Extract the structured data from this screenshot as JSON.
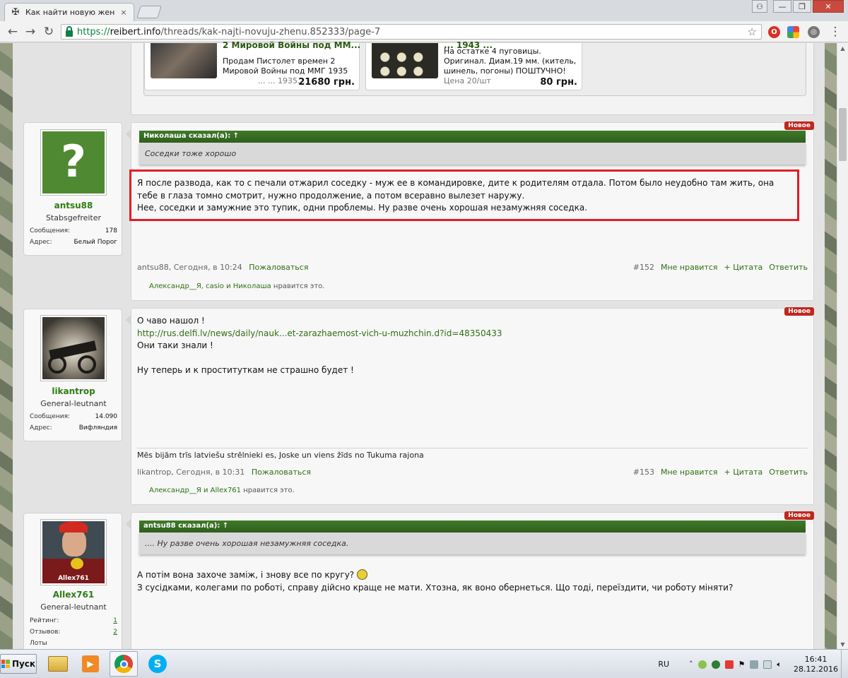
{
  "browser": {
    "tab_title": "Как найти новую жену?",
    "tab_close": "×",
    "url_scheme": "https://",
    "url_host": "reibert.info",
    "url_path": "/threads/kak-najti-novuju-zhenu.852333/page-7",
    "nav": {
      "back": "←",
      "forward": "→",
      "reload": "↻"
    },
    "star": "☆",
    "window_buttons": {
      "user": "⚇",
      "minimize": "—",
      "restore": "❐",
      "close": "✕"
    }
  },
  "ads": [
    {
      "title": "2 Мировой Войны под ММ...",
      "lines": [
        "Продам Пистолет времен 2",
        "Мировой Войны под ММГ 1935"
      ],
      "cut": "... ... 1935...",
      "price": "21680 грн."
    },
    {
      "title": "... 1943 ...",
      "lines": [
        "На остатке 4 пуговицы.",
        "Оригинал. Диам.19 мм. (китель,",
        "шинель, погоны) ПОШТУЧНО!"
      ],
      "cut": "Цена 20/шт",
      "price": "80 грн."
    }
  ],
  "posts": [
    {
      "username": "antsu88",
      "rank": "Stabsgefreiter",
      "stats": [
        {
          "label": "Сообщения:",
          "value": "178"
        },
        {
          "label": "Адрес:",
          "value": "Белый Порог"
        }
      ],
      "badge": "Новое",
      "quote_head": "Николаша сказал(а): ↑",
      "quote_body": "Соседки тоже хорошо",
      "message_lines": [
        "Я после развода, как то с печали отжарил соседку - муж ее в командировке, дите к родителям отдала. Потом было неудобно там жить, она",
        "тебе в глаза томно смотрит, нужно продолжение, а потом всеравно вылезет наружу.",
        "Нее, соседки и замужние это тупик, одни проблемы. Ну разве очень хорошая незамужняя соседка."
      ],
      "meta_author": "antsu88, Сегодня, в 10:24",
      "report": "Пожаловаться",
      "number": "#152",
      "like": "Мне нравится",
      "quote_btn": "+ Цитата",
      "reply": "Ответить",
      "likes_names": "Александр__Я, casio и Николаша",
      "likes_suffix": " нравится это."
    },
    {
      "username": "likantrop",
      "rank": "General-leutnant",
      "stats": [
        {
          "label": "Сообщения:",
          "value": "14.090"
        },
        {
          "label": "Адрес:",
          "value": "Вифляндия"
        }
      ],
      "badge": "Новое",
      "message_lines": [
        "О чаво нашол !",
        "http://rus.delfi.lv/news/daily/nauk...et-zarazhaemost-vich-u-muzhchin.d?id=48350433",
        "Они таки знали !",
        "",
        "Ну теперь и к проституткам не страшно будет !"
      ],
      "signature": "Mēs bijām trīs latviešu strēlnieki es, Joske un viens žīds no Tukuma rajona",
      "meta_author": "likantrop, Сегодня, в 10:31",
      "report": "Пожаловаться",
      "number": "#153",
      "like": "Мне нравится",
      "quote_btn": "+ Цитата",
      "reply": "Ответить",
      "likes_names": "Александр__Я и Allex761",
      "likes_suffix": " нравится это."
    },
    {
      "username": "Allex761",
      "rank": "General-leutnant",
      "avatar_caption": "Allex761",
      "stats": [
        {
          "label": "Рейтинг:",
          "value": "1"
        },
        {
          "label": "Отзывов:",
          "value": "2"
        },
        {
          "label": "Лоты",
          "value": ""
        }
      ],
      "badge": "Новое",
      "quote_head": "antsu88 сказал(а): ↑",
      "quote_body": ".... Ну разве очень хорошая незамужняя соседка.",
      "message_lines": [
        "А потім вона захоче заміж, і знову все по кругу?",
        "З сусідками, колегами по роботі, справу дійсно краще не мати. Хтозна, як воно обернеться. Що тоді, переїздити, чи роботу міняти?"
      ]
    }
  ],
  "taskbar": {
    "start": "Пуск",
    "lang": "RU",
    "time": "16:41",
    "date": "28.12.2016"
  }
}
